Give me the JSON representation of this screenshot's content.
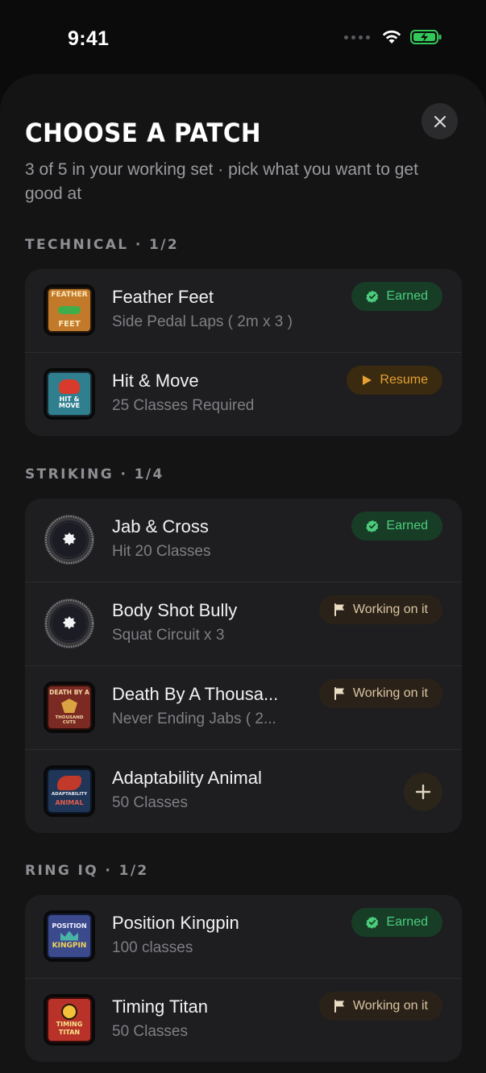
{
  "status": {
    "time": "9:41"
  },
  "header": {
    "title": "CHOOSE A PATCH",
    "subtitle": "3 of 5 in your working set · pick what you want to get good at"
  },
  "sections": [
    {
      "label": "TECHNICAL · 1/2",
      "items": [
        {
          "title": "Feather Feet",
          "subtitle": "Side Pedal Laps ( 2m x 3 )",
          "status": "Earned",
          "badge_text": [
            "FEATHER",
            "FEET"
          ]
        },
        {
          "title": "Hit & Move",
          "subtitle": "25 Classes Required",
          "status": "Resume",
          "badge_text": [
            "HIT & MOVE"
          ]
        }
      ]
    },
    {
      "label": "STRIKING · 1/4",
      "items": [
        {
          "title": "Jab & Cross",
          "subtitle": "Hit 20 Classes",
          "status": "Earned"
        },
        {
          "title": "Body Shot Bully",
          "subtitle": "Squat Circuit x 3",
          "status": "Working on it"
        },
        {
          "title": "Death By A Thousa...",
          "subtitle": "Never Ending Jabs ( 2...",
          "status": "Working on it",
          "badge_text": [
            "DEATH BY A",
            "THOUSAND CUTS"
          ]
        },
        {
          "title": "Adaptability Animal",
          "subtitle": "50 Classes",
          "status": "add",
          "badge_text": [
            "ADAPTABILITY",
            "ANIMAL"
          ]
        }
      ]
    },
    {
      "label": "RING IQ · 1/2",
      "items": [
        {
          "title": "Position Kingpin",
          "subtitle": "100 classes",
          "status": "Earned",
          "badge_text": [
            "POSITION",
            "KINGPIN"
          ]
        },
        {
          "title": "Timing Titan",
          "subtitle": "50 Classes",
          "status": "Working on it",
          "badge_text": [
            "TIMING",
            "TITAN"
          ]
        }
      ]
    }
  ],
  "colors": {
    "earned": "#4ccd7c",
    "resume": "#e5a233",
    "working": "#d9c4a2",
    "battery": "#34c759"
  }
}
